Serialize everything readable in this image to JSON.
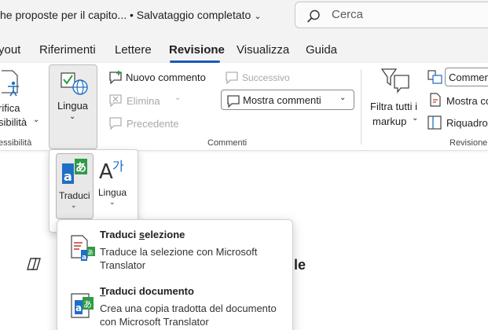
{
  "titlebar": {
    "doc_title": "he proposte per il capito... • Salvataggio completato",
    "search_placeholder": "Cerca"
  },
  "tabs": [
    {
      "label": "yout"
    },
    {
      "label": "Riferimenti"
    },
    {
      "label": "Lettere"
    },
    {
      "label": "Revisione",
      "active": true
    },
    {
      "label": "Visualizza"
    },
    {
      "label": "Guida"
    }
  ],
  "ribbon": {
    "accessibility": {
      "line1": "rifica",
      "line2": "sibilità",
      "group": "essibilità"
    },
    "lingua": {
      "label": "Lingua"
    },
    "comments": {
      "new": "Nuovo commento",
      "next": "Successivo",
      "delete": "Elimina",
      "prev": "Precedente",
      "show": "Mostra commenti",
      "group": "Commenti"
    },
    "tracking": {
      "filter_line1": "Filtra tutti i",
      "filter_line2": "markup",
      "comment_box": "Commen",
      "show_comments": "Mostra co",
      "pane": "Riquadro",
      "group": "Revisione"
    }
  },
  "lingua_menu": {
    "traduci": "Traduci",
    "lingua": "Lingua"
  },
  "translate_menu": {
    "items": [
      {
        "title_pre": "Traduci ",
        "title_ul": "s",
        "title_post": "elezione",
        "desc": "Traduce la selezione con Microsoft Translator"
      },
      {
        "title_pre": "",
        "title_ul": "T",
        "title_post": "raduci documento",
        "desc": "Crea una copia tradotta del documento con Microsoft Translator"
      }
    ]
  },
  "document": {
    "heading_fragment": "le"
  },
  "colors": {
    "accent": "#185abd",
    "translator_green": "#2e9b47",
    "translator_blue": "#1f6fc5"
  }
}
